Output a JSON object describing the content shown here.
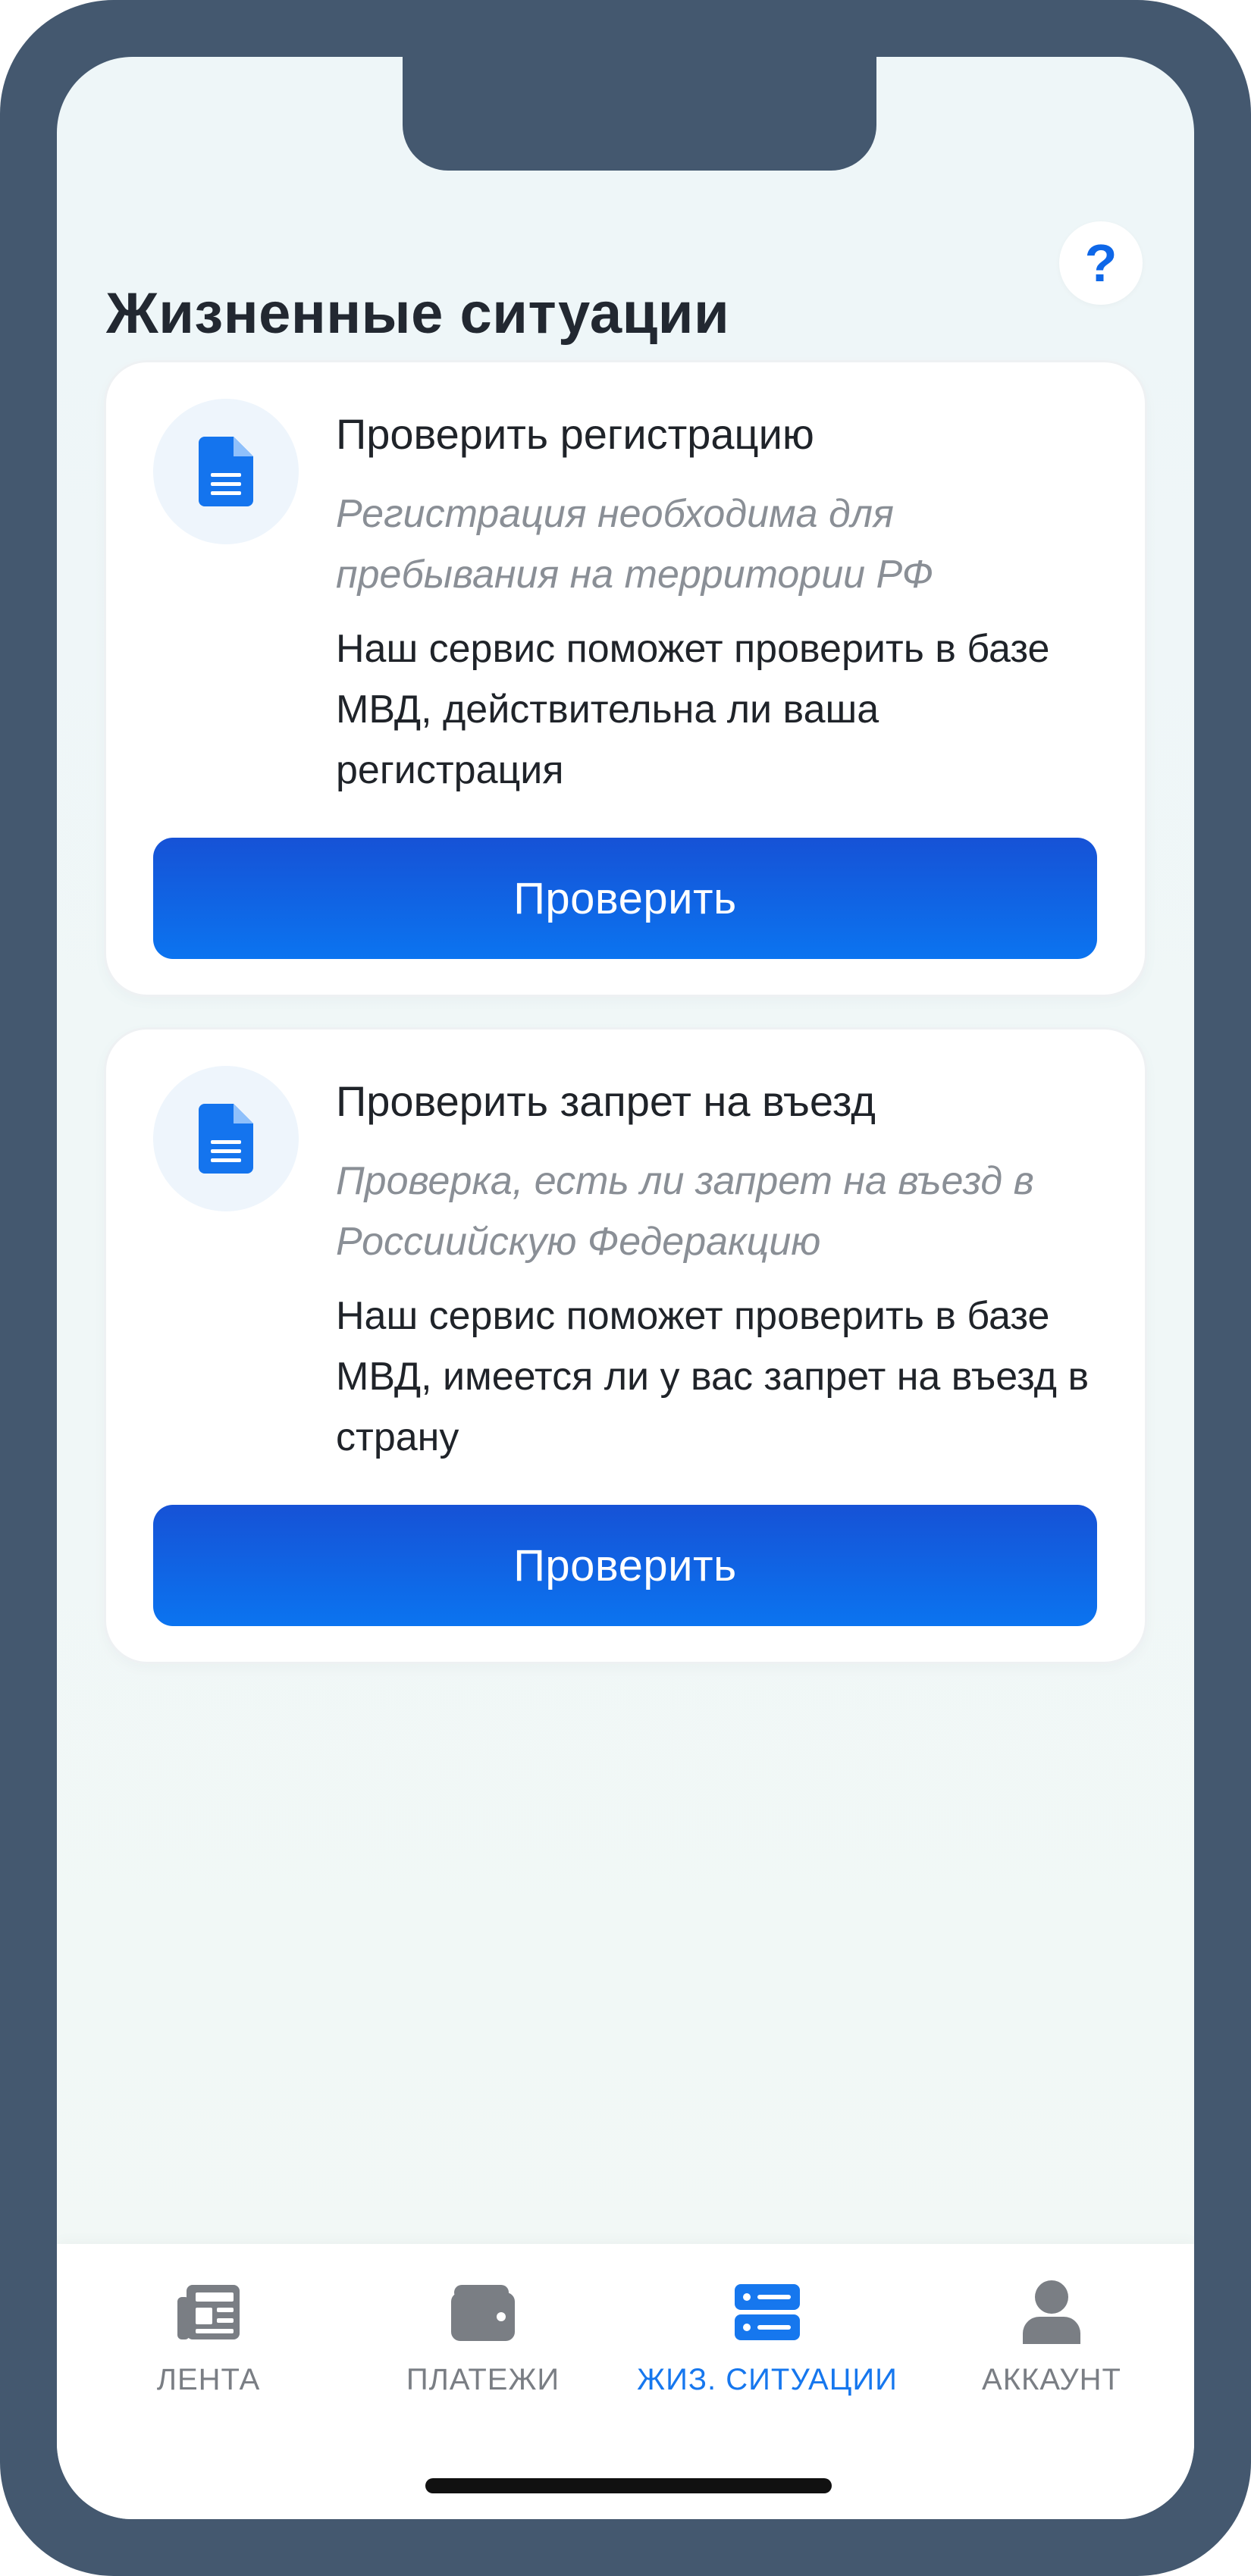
{
  "header": {
    "title": "Жизненные ситуации",
    "help_label": "?"
  },
  "cards": [
    {
      "icon": "document-icon",
      "title": "Проверить регистрацию",
      "subtitle": "Регистрация необходима для пребывания на территории РФ",
      "description": "Наш сервис поможет проверить в базе МВД, действительна ли ваша регистрация",
      "button_label": "Проверить"
    },
    {
      "icon": "document-icon",
      "title": "Проверить запрет на въезд",
      "subtitle": "Проверка, есть ли запрет на въезд в Россиийскую Федеракцию",
      "description": "Наш сервис поможет проверить в базе МВД, имеется ли у вас запрет на въезд в страну",
      "button_label": "Проверить"
    }
  ],
  "tabbar": {
    "items": [
      {
        "label": "ЛЕНТА",
        "icon": "newspaper-icon",
        "active": false
      },
      {
        "label": "ПЛАТЕЖИ",
        "icon": "wallet-icon",
        "active": false
      },
      {
        "label": "ЖИЗ. СИТУАЦИИ",
        "icon": "server-icon",
        "active": true
      },
      {
        "label": "АККАУНТ",
        "icon": "user-icon",
        "active": false
      }
    ]
  },
  "colors": {
    "accent": "#0e67e8",
    "button_gradient_top": "#1652d6",
    "button_gradient_bottom": "#0b74f0",
    "frame": "#44586f",
    "inactive_tab": "#7a7e84"
  }
}
